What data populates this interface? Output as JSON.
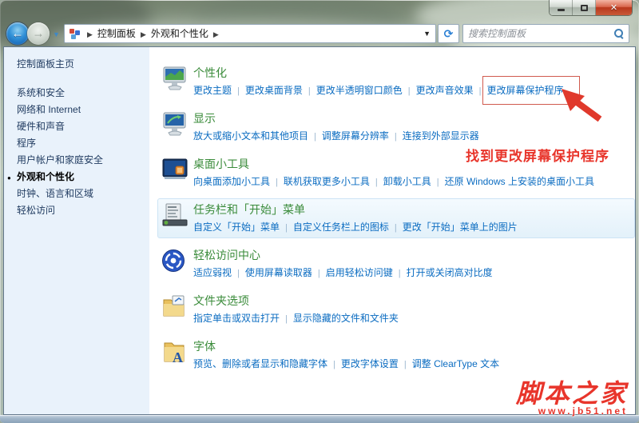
{
  "window": {
    "controls": {
      "minimize": "minimize",
      "maximize": "maximize",
      "close": "close"
    }
  },
  "toolbar": {
    "breadcrumb": {
      "items": [
        "控制面板",
        "外观和个性化"
      ]
    },
    "search": {
      "placeholder": "搜索控制面板"
    }
  },
  "sidebar": {
    "home": "控制面板主页",
    "items": [
      {
        "label": "系统和安全",
        "current": false
      },
      {
        "label": "网络和 Internet",
        "current": false
      },
      {
        "label": "硬件和声音",
        "current": false
      },
      {
        "label": "程序",
        "current": false
      },
      {
        "label": "用户帐户和家庭安全",
        "current": false
      },
      {
        "label": "外观和个性化",
        "current": true
      },
      {
        "label": "时钟、语言和区域",
        "current": false
      },
      {
        "label": "轻松访问",
        "current": false
      }
    ]
  },
  "main": {
    "sections": [
      {
        "title": "个性化",
        "icon": "personalization-monitor-icon",
        "links": [
          "更改主题",
          "更改桌面背景",
          "更改半透明窗口颜色",
          "更改声音效果",
          "更改屏幕保护程序"
        ],
        "boxed_link_index": 4,
        "highlighted": false
      },
      {
        "title": "显示",
        "icon": "display-monitor-icon",
        "links": [
          "放大或缩小文本和其他项目",
          "调整屏幕分辨率",
          "连接到外部显示器"
        ],
        "boxed_link_index": -1,
        "highlighted": false
      },
      {
        "title": "桌面小工具",
        "icon": "desktop-gadgets-icon",
        "links": [
          "向桌面添加小工具",
          "联机获取更多小工具",
          "卸载小工具",
          "还原 Windows 上安装的桌面小工具"
        ],
        "boxed_link_index": -1,
        "highlighted": false
      },
      {
        "title": "任务栏和「开始」菜单",
        "icon": "taskbar-start-menu-icon",
        "links": [
          "自定义「开始」菜单",
          "自定义任务栏上的图标",
          "更改「开始」菜单上的图片"
        ],
        "boxed_link_index": -1,
        "highlighted": true
      },
      {
        "title": "轻松访问中心",
        "icon": "ease-of-access-icon",
        "links": [
          "适应弱视",
          "使用屏幕读取器",
          "启用轻松访问键",
          "打开或关闭高对比度"
        ],
        "boxed_link_index": -1,
        "highlighted": false
      },
      {
        "title": "文件夹选项",
        "icon": "folder-options-icon",
        "links": [
          "指定单击或双击打开",
          "显示隐藏的文件和文件夹"
        ],
        "boxed_link_index": -1,
        "highlighted": false
      },
      {
        "title": "字体",
        "icon": "fonts-icon",
        "links": [
          "预览、删除或者显示和隐藏字体",
          "更改字体设置",
          "调整 ClearType 文本"
        ],
        "boxed_link_index": -1,
        "highlighted": false
      }
    ]
  },
  "annotation": {
    "text": "找到更改屏幕保护程序",
    "color": "#e8352b"
  },
  "watermark": {
    "site_name": "脚本之家",
    "site_url": "www.jb51.net"
  },
  "colors": {
    "link_blue": "#0b6cc1",
    "heading_green": "#3a8b3a",
    "sidebar_bg": "#e9f2fb",
    "annotation_red": "#e8352b"
  }
}
